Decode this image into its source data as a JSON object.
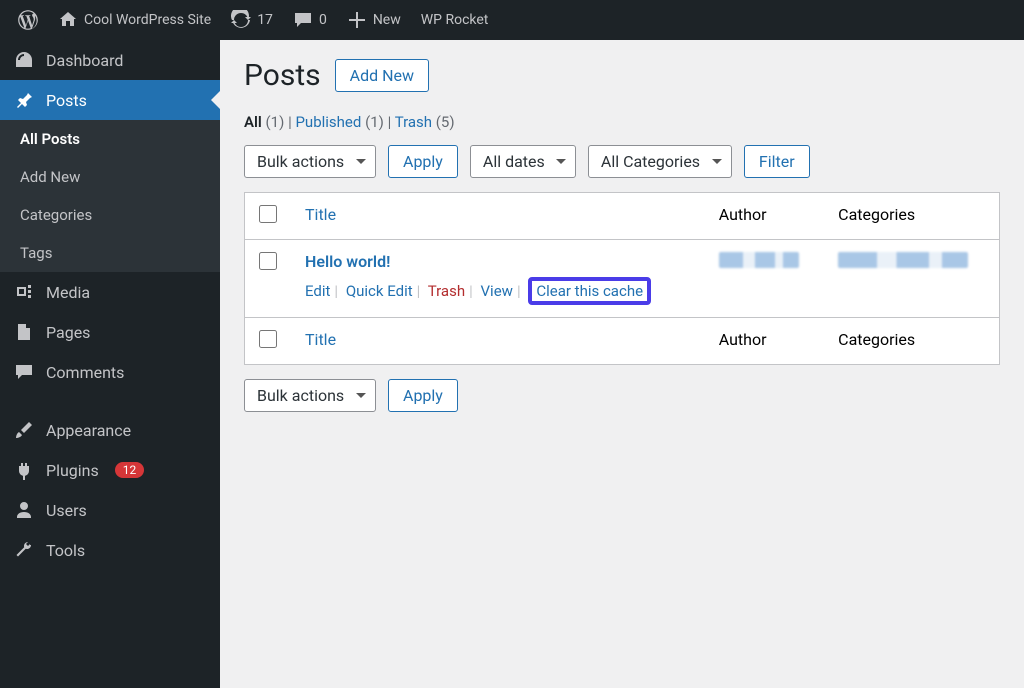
{
  "adminbar": {
    "site_name": "Cool WordPress Site",
    "updates": "17",
    "comments": "0",
    "new": "New",
    "wp_rocket": "WP Rocket"
  },
  "sidebar": {
    "dashboard": "Dashboard",
    "posts": "Posts",
    "submenu": {
      "all_posts": "All Posts",
      "add_new": "Add New",
      "categories": "Categories",
      "tags": "Tags"
    },
    "media": "Media",
    "pages": "Pages",
    "comments": "Comments",
    "appearance": "Appearance",
    "plugins": "Plugins",
    "plugins_badge": "12",
    "users": "Users",
    "tools": "Tools"
  },
  "page": {
    "title": "Posts",
    "add_new": "Add New"
  },
  "filter_links": {
    "all": "All",
    "all_count": "(1)",
    "published": "Published",
    "published_count": "(1)",
    "trash": "Trash",
    "trash_count": "(5)"
  },
  "controls": {
    "bulk_actions": "Bulk actions",
    "apply": "Apply",
    "all_dates": "All dates",
    "all_categories": "All Categories",
    "filter": "Filter"
  },
  "columns": {
    "title": "Title",
    "author": "Author",
    "categories": "Categories"
  },
  "rows": [
    {
      "title": "Hello world!",
      "actions": {
        "edit": "Edit",
        "quick_edit": "Quick Edit",
        "trash": "Trash",
        "view": "View",
        "clear_cache": "Clear this cache"
      }
    }
  ]
}
